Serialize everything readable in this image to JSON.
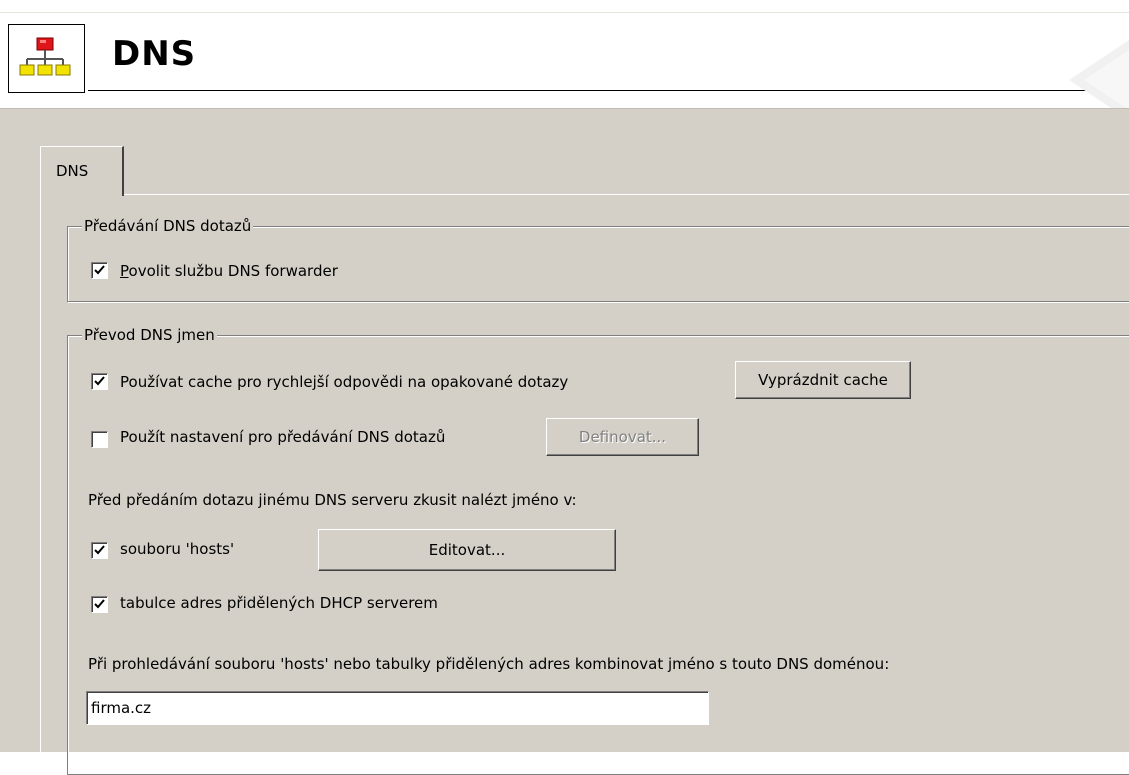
{
  "header": {
    "title": "DNS",
    "icon": "network-tree-icon"
  },
  "tabs": [
    {
      "label": "DNS",
      "selected": true
    }
  ],
  "forwarding_group": {
    "legend": "Předávání DNS dotazů",
    "enable_forwarder": {
      "prefix": "P",
      "rest": "ovolit službu DNS forwarder",
      "checked": true
    }
  },
  "resolution_group": {
    "legend": "Převod DNS jmen",
    "use_cache": {
      "label": "Používat cache pro rychlejší odpovědi na opakované dotazy",
      "checked": true
    },
    "clear_cache_button": "Vyprázdnit cache",
    "use_forwarding_settings": {
      "label": "Použít nastavení pro předávání DNS dotazů",
      "checked": false
    },
    "define_button": "Definovat...",
    "lookup_intro": "Před předáním dotazu jinému DNS serveru zkusit nalézt jméno v:",
    "hosts_file": {
      "label": "souboru 'hosts'",
      "checked": true
    },
    "edit_button": "Editovat...",
    "dhcp_table": {
      "label": "tabulce adres přidělených DHCP serverem",
      "checked": true
    },
    "domain_intro": "Při prohledávání souboru 'hosts' nebo tabulky přidělených adres kombinovat jméno s touto DNS doménou:",
    "domain_value": "firma.cz"
  }
}
